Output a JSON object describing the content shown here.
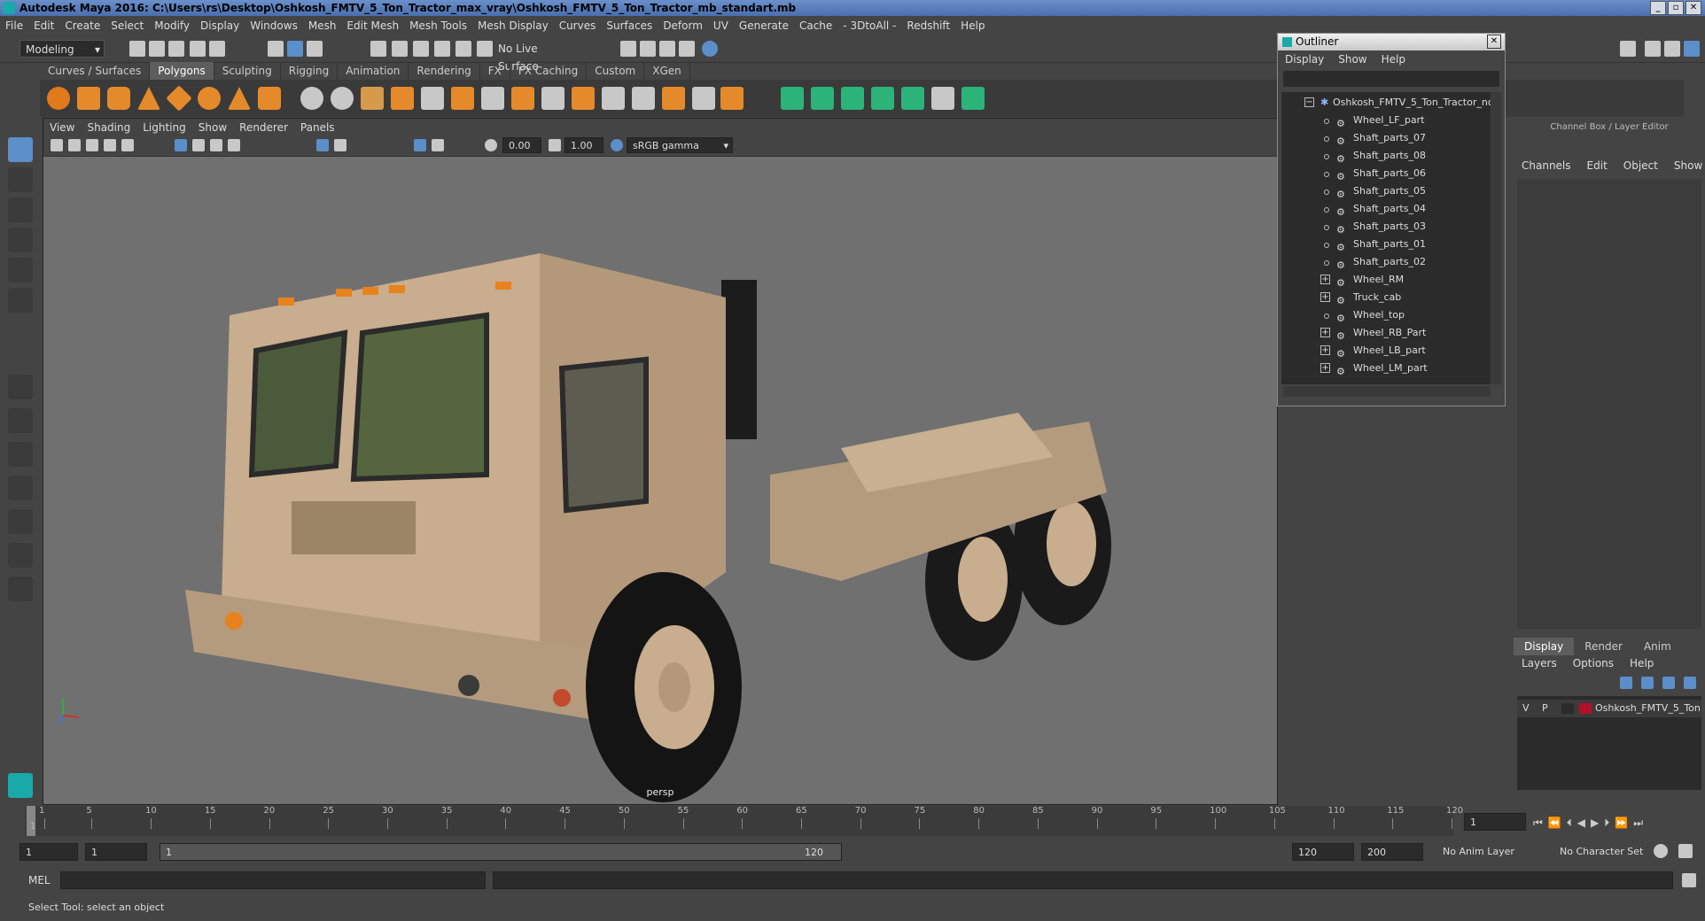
{
  "window": {
    "title": "Autodesk Maya 2016: C:\\Users\\rs\\Desktop\\Oshkosh_FMTV_5_Ton_Tractor_max_vray\\Oshkosh_FMTV_5_Ton_Tractor_mb_standart.mb",
    "controls": [
      "_",
      "▫",
      "✕"
    ]
  },
  "menubar": [
    "File",
    "Edit",
    "Create",
    "Select",
    "Modify",
    "Display",
    "Windows",
    "Mesh",
    "Edit Mesh",
    "Mesh Tools",
    "Mesh Display",
    "Curves",
    "Surfaces",
    "Deform",
    "UV",
    "Generate",
    "Cache",
    "- 3DtoAll -",
    "Redshift",
    "Help"
  ],
  "toolbar": {
    "mode": "Modeling",
    "live_surface": "No Live Surface"
  },
  "shelf": {
    "tabs": [
      "Curves / Surfaces",
      "Polygons",
      "Sculpting",
      "Rigging",
      "Animation",
      "Rendering",
      "FX",
      "FX Caching",
      "Custom",
      "XGen"
    ],
    "active_tab": "Polygons"
  },
  "viewport": {
    "menu": [
      "View",
      "Shading",
      "Lighting",
      "Show",
      "Renderer",
      "Panels"
    ],
    "exposure": "0.00",
    "gamma": "1.00",
    "color_space": "sRGB gamma",
    "camera_label": "persp",
    "axis_labels": [
      "y",
      "x"
    ]
  },
  "outliner": {
    "title": "Outliner",
    "menu": [
      "Display",
      "Show",
      "Help"
    ],
    "root": "Oshkosh_FMTV_5_Ton_Tractor_nc",
    "items": [
      {
        "label": "Wheel_LF_part",
        "expandable": false
      },
      {
        "label": "Shaft_parts_07",
        "expandable": false
      },
      {
        "label": "Shaft_parts_08",
        "expandable": false
      },
      {
        "label": "Shaft_parts_06",
        "expandable": false
      },
      {
        "label": "Shaft_parts_05",
        "expandable": false
      },
      {
        "label": "Shaft_parts_04",
        "expandable": false
      },
      {
        "label": "Shaft_parts_03",
        "expandable": false
      },
      {
        "label": "Shaft_parts_01",
        "expandable": false
      },
      {
        "label": "Shaft_parts_02",
        "expandable": false
      },
      {
        "label": "Wheel_RM",
        "expandable": true
      },
      {
        "label": "Truck_cab",
        "expandable": true
      },
      {
        "label": "Wheel_top",
        "expandable": false
      },
      {
        "label": "Wheel_RB_Part",
        "expandable": true
      },
      {
        "label": "Wheel_LB_part",
        "expandable": true
      },
      {
        "label": "Wheel_LM_part",
        "expandable": true
      }
    ]
  },
  "channel_box": {
    "header": "Channel Box / Layer Editor",
    "menu": [
      "Channels",
      "Edit",
      "Object",
      "Show"
    ],
    "tabs": [
      "Display",
      "Render",
      "Anim"
    ],
    "active_tab": "Display",
    "layer_menu": [
      "Layers",
      "Options",
      "Help"
    ],
    "layer": {
      "v": "V",
      "p": "P",
      "name": "Oshkosh_FMTV_5_Ton",
      "color": "#b0102a"
    }
  },
  "timeline": {
    "ticks": [
      "1",
      "5",
      "10",
      "15",
      "20",
      "25",
      "30",
      "35",
      "40",
      "45",
      "50",
      "55",
      "60",
      "65",
      "70",
      "75",
      "80",
      "85",
      "90",
      "95",
      "100",
      "105",
      "110",
      "115",
      "120"
    ],
    "current_frame": "1"
  },
  "range": {
    "start": "1",
    "playback_start": "1",
    "slider_start": "1",
    "slider_end": "120",
    "playback_end": "120",
    "end": "200",
    "anim_layer": "No Anim Layer",
    "character_set": "No Character Set"
  },
  "command": {
    "label": "MEL"
  },
  "help_line": "Select Tool: select an object",
  "colors": {
    "accent": "#5d8fc8",
    "truck": "#c8ad8e",
    "viewport_bg": "#707070"
  }
}
